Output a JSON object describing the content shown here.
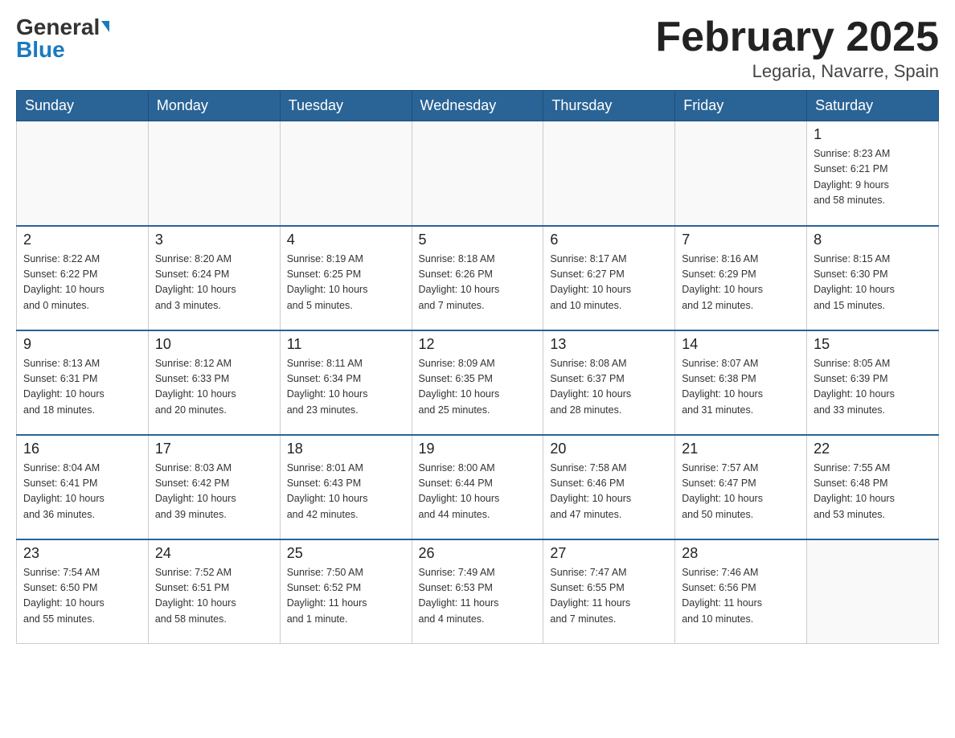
{
  "header": {
    "logo_general": "General",
    "logo_blue": "Blue",
    "month_title": "February 2025",
    "location": "Legaria, Navarre, Spain"
  },
  "weekdays": [
    "Sunday",
    "Monday",
    "Tuesday",
    "Wednesday",
    "Thursday",
    "Friday",
    "Saturday"
  ],
  "weeks": [
    [
      {
        "day": "",
        "info": ""
      },
      {
        "day": "",
        "info": ""
      },
      {
        "day": "",
        "info": ""
      },
      {
        "day": "",
        "info": ""
      },
      {
        "day": "",
        "info": ""
      },
      {
        "day": "",
        "info": ""
      },
      {
        "day": "1",
        "info": "Sunrise: 8:23 AM\nSunset: 6:21 PM\nDaylight: 9 hours\nand 58 minutes."
      }
    ],
    [
      {
        "day": "2",
        "info": "Sunrise: 8:22 AM\nSunset: 6:22 PM\nDaylight: 10 hours\nand 0 minutes."
      },
      {
        "day": "3",
        "info": "Sunrise: 8:20 AM\nSunset: 6:24 PM\nDaylight: 10 hours\nand 3 minutes."
      },
      {
        "day": "4",
        "info": "Sunrise: 8:19 AM\nSunset: 6:25 PM\nDaylight: 10 hours\nand 5 minutes."
      },
      {
        "day": "5",
        "info": "Sunrise: 8:18 AM\nSunset: 6:26 PM\nDaylight: 10 hours\nand 7 minutes."
      },
      {
        "day": "6",
        "info": "Sunrise: 8:17 AM\nSunset: 6:27 PM\nDaylight: 10 hours\nand 10 minutes."
      },
      {
        "day": "7",
        "info": "Sunrise: 8:16 AM\nSunset: 6:29 PM\nDaylight: 10 hours\nand 12 minutes."
      },
      {
        "day": "8",
        "info": "Sunrise: 8:15 AM\nSunset: 6:30 PM\nDaylight: 10 hours\nand 15 minutes."
      }
    ],
    [
      {
        "day": "9",
        "info": "Sunrise: 8:13 AM\nSunset: 6:31 PM\nDaylight: 10 hours\nand 18 minutes."
      },
      {
        "day": "10",
        "info": "Sunrise: 8:12 AM\nSunset: 6:33 PM\nDaylight: 10 hours\nand 20 minutes."
      },
      {
        "day": "11",
        "info": "Sunrise: 8:11 AM\nSunset: 6:34 PM\nDaylight: 10 hours\nand 23 minutes."
      },
      {
        "day": "12",
        "info": "Sunrise: 8:09 AM\nSunset: 6:35 PM\nDaylight: 10 hours\nand 25 minutes."
      },
      {
        "day": "13",
        "info": "Sunrise: 8:08 AM\nSunset: 6:37 PM\nDaylight: 10 hours\nand 28 minutes."
      },
      {
        "day": "14",
        "info": "Sunrise: 8:07 AM\nSunset: 6:38 PM\nDaylight: 10 hours\nand 31 minutes."
      },
      {
        "day": "15",
        "info": "Sunrise: 8:05 AM\nSunset: 6:39 PM\nDaylight: 10 hours\nand 33 minutes."
      }
    ],
    [
      {
        "day": "16",
        "info": "Sunrise: 8:04 AM\nSunset: 6:41 PM\nDaylight: 10 hours\nand 36 minutes."
      },
      {
        "day": "17",
        "info": "Sunrise: 8:03 AM\nSunset: 6:42 PM\nDaylight: 10 hours\nand 39 minutes."
      },
      {
        "day": "18",
        "info": "Sunrise: 8:01 AM\nSunset: 6:43 PM\nDaylight: 10 hours\nand 42 minutes."
      },
      {
        "day": "19",
        "info": "Sunrise: 8:00 AM\nSunset: 6:44 PM\nDaylight: 10 hours\nand 44 minutes."
      },
      {
        "day": "20",
        "info": "Sunrise: 7:58 AM\nSunset: 6:46 PM\nDaylight: 10 hours\nand 47 minutes."
      },
      {
        "day": "21",
        "info": "Sunrise: 7:57 AM\nSunset: 6:47 PM\nDaylight: 10 hours\nand 50 minutes."
      },
      {
        "day": "22",
        "info": "Sunrise: 7:55 AM\nSunset: 6:48 PM\nDaylight: 10 hours\nand 53 minutes."
      }
    ],
    [
      {
        "day": "23",
        "info": "Sunrise: 7:54 AM\nSunset: 6:50 PM\nDaylight: 10 hours\nand 55 minutes."
      },
      {
        "day": "24",
        "info": "Sunrise: 7:52 AM\nSunset: 6:51 PM\nDaylight: 10 hours\nand 58 minutes."
      },
      {
        "day": "25",
        "info": "Sunrise: 7:50 AM\nSunset: 6:52 PM\nDaylight: 11 hours\nand 1 minute."
      },
      {
        "day": "26",
        "info": "Sunrise: 7:49 AM\nSunset: 6:53 PM\nDaylight: 11 hours\nand 4 minutes."
      },
      {
        "day": "27",
        "info": "Sunrise: 7:47 AM\nSunset: 6:55 PM\nDaylight: 11 hours\nand 7 minutes."
      },
      {
        "day": "28",
        "info": "Sunrise: 7:46 AM\nSunset: 6:56 PM\nDaylight: 11 hours\nand 10 minutes."
      },
      {
        "day": "",
        "info": ""
      }
    ]
  ]
}
